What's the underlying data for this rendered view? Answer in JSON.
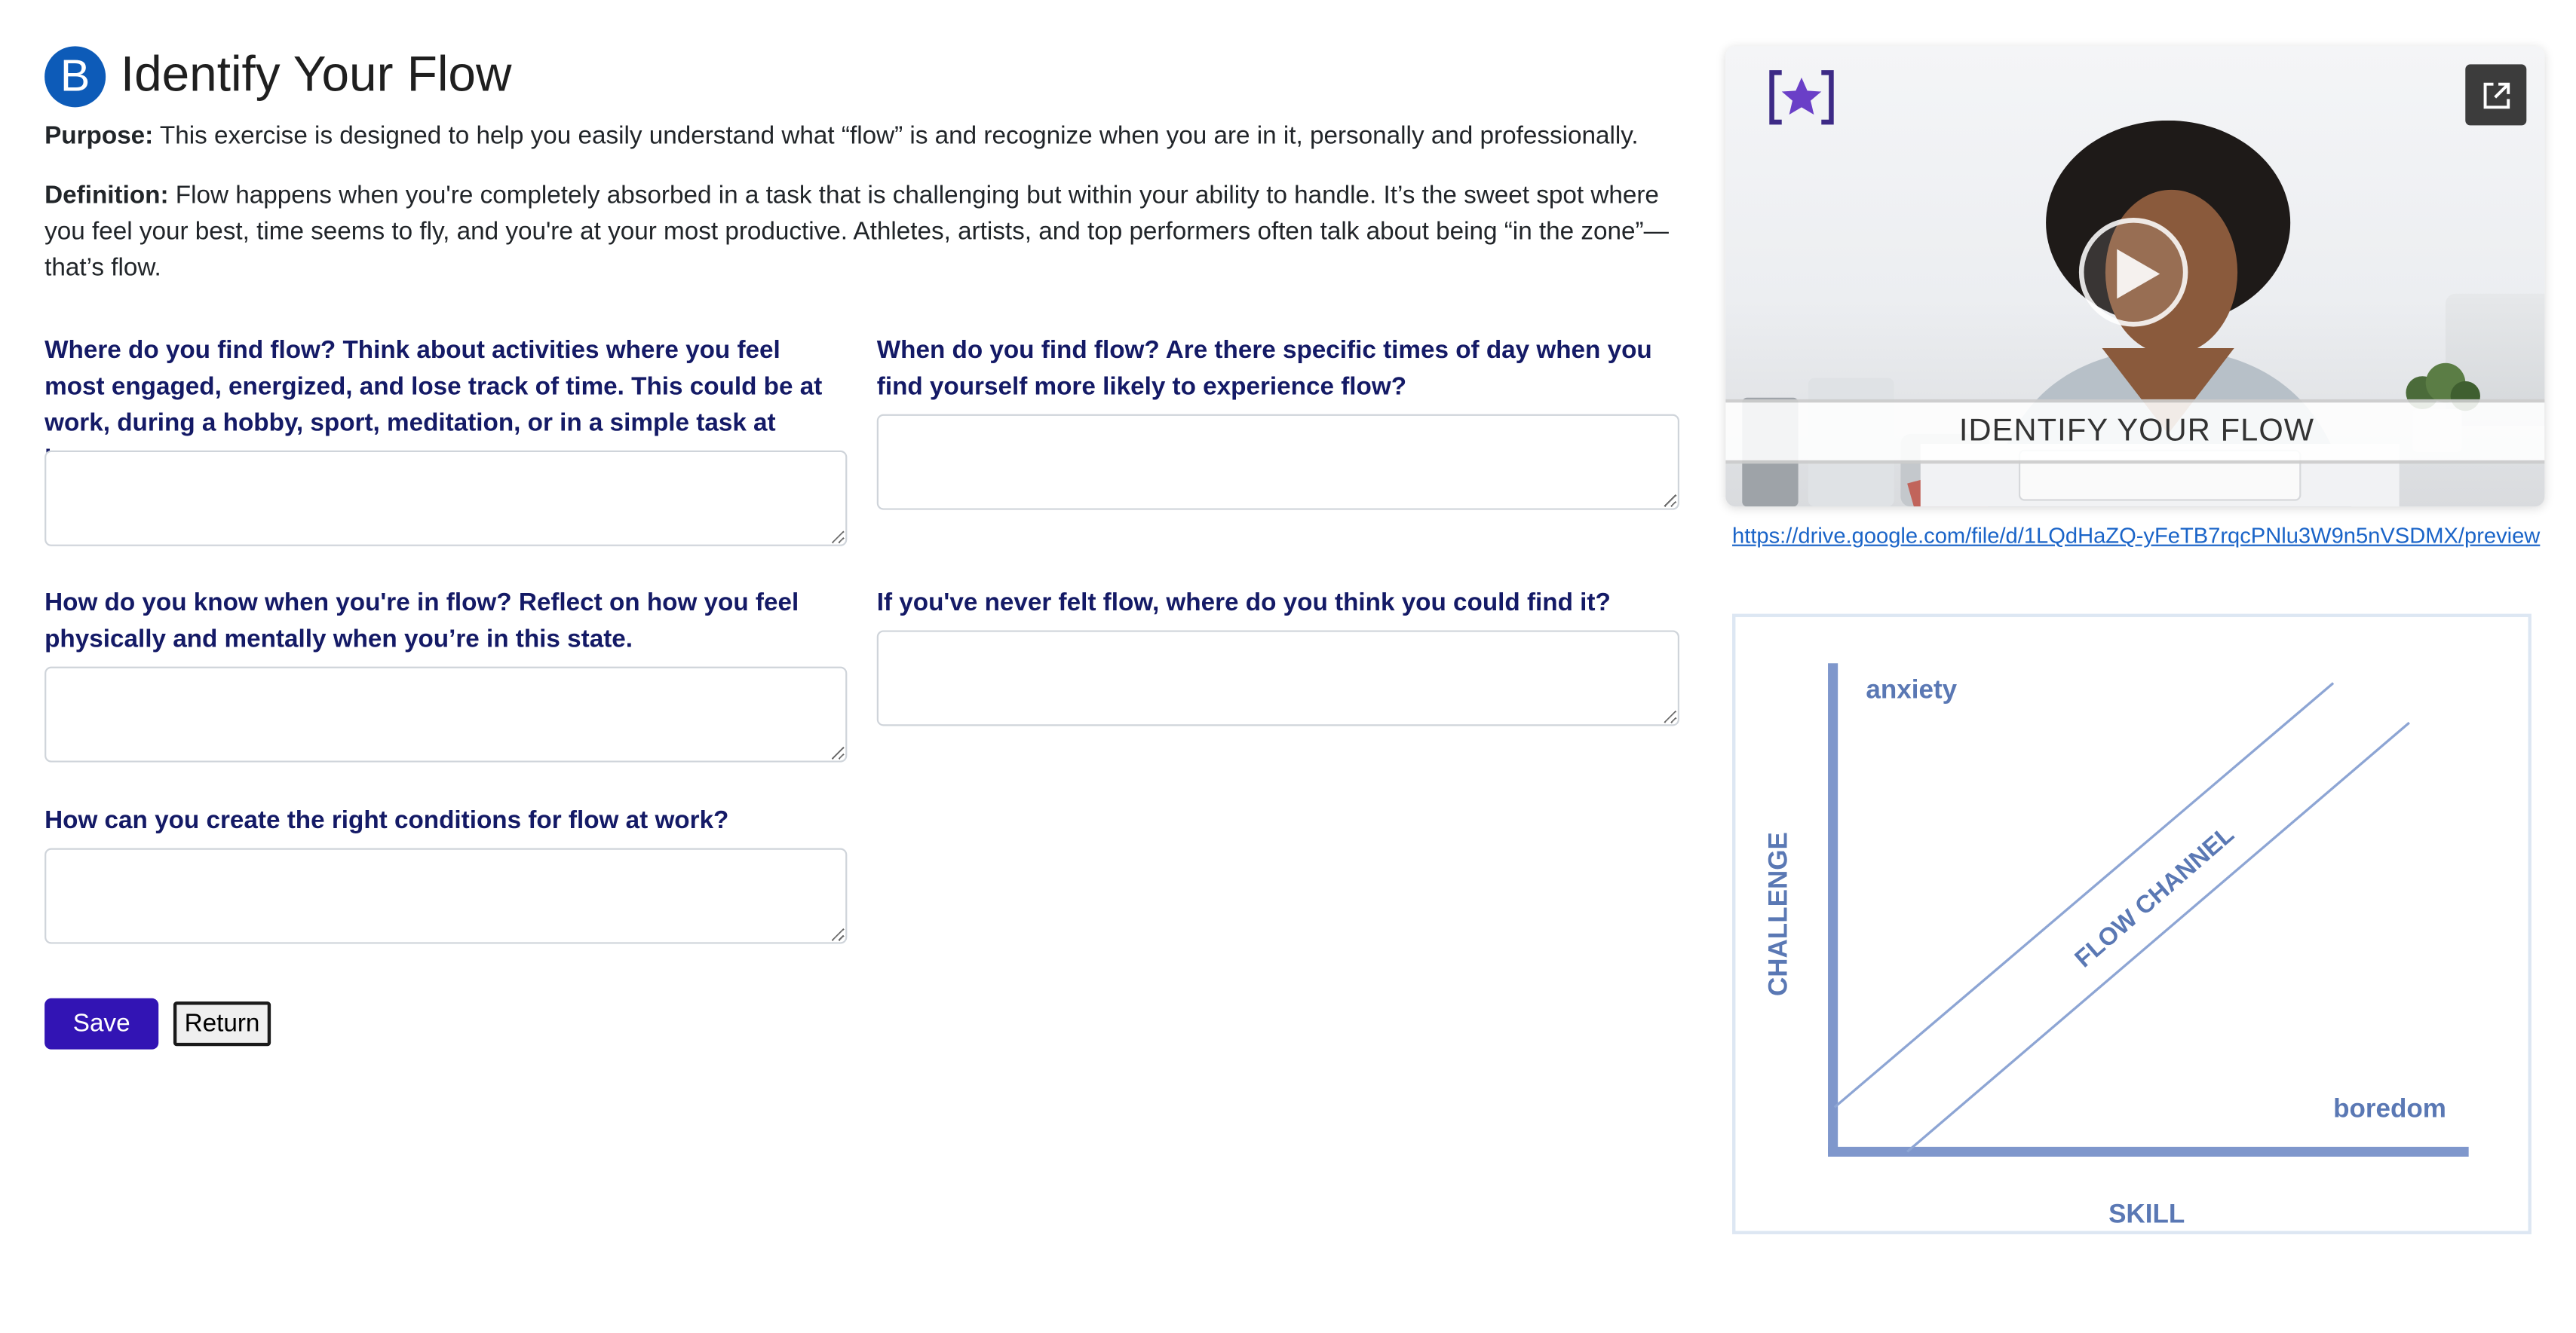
{
  "header": {
    "badge_letter": "B",
    "title": "Identify Your Flow"
  },
  "intro": {
    "purpose_label": "Purpose:",
    "purpose_text": " This exercise is designed to help you easily understand what “flow” is and recognize when you are in it, personally and professionally.",
    "definition_label": "Definition:",
    "definition_text": " Flow happens when you're completely absorbed in a task that is challenging but within your ability to handle. It’s the sweet spot where you feel your best, time seems to fly, and you're at your most productive. Athletes, artists, and top performers often talk about being “in the zone”—that’s flow."
  },
  "questions": [
    {
      "label": "Where do you find flow? Think about activities where you feel most engaged, energized, and lose track of time. This could be at work, during a hobby, sport, meditation, or in a simple task at home.",
      "value": ""
    },
    {
      "label": "When do you find flow? Are there specific times of day when you find yourself more likely to experience flow?",
      "value": ""
    },
    {
      "label": "How do you know when you're in flow? Reflect on how you feel physically and mentally when you’re in this state.",
      "value": ""
    },
    {
      "label": "If you've never felt flow, where do you think you could find it?",
      "value": ""
    },
    {
      "label": "How can you create the right conditions for flow at work?",
      "value": ""
    }
  ],
  "actions": {
    "save_label": "Save",
    "return_label": "Return"
  },
  "video": {
    "banner_title": "IDENTIFY YOUR FLOW",
    "link_text": "https://drive.google.com/file/d/1LQdHaZQ-yFeTB7rqcPNlu3W9n5nVSDMX/preview",
    "icons": [
      "brand-star-logo-icon",
      "play-icon",
      "open-external-icon"
    ],
    "accent_color": "#3214b4"
  },
  "diagram": {
    "label_anxiety": "anxiety",
    "label_boredom": "boredom",
    "label_channel": "FLOW CHANNEL",
    "axis_y": "CHALLENGE",
    "axis_x": "SKILL",
    "color": "#5a78b4"
  },
  "colors": {
    "question_text": "#141a66",
    "badge": "#0d5bb8",
    "save_button": "#3214b4",
    "link": "#1a64c8"
  }
}
